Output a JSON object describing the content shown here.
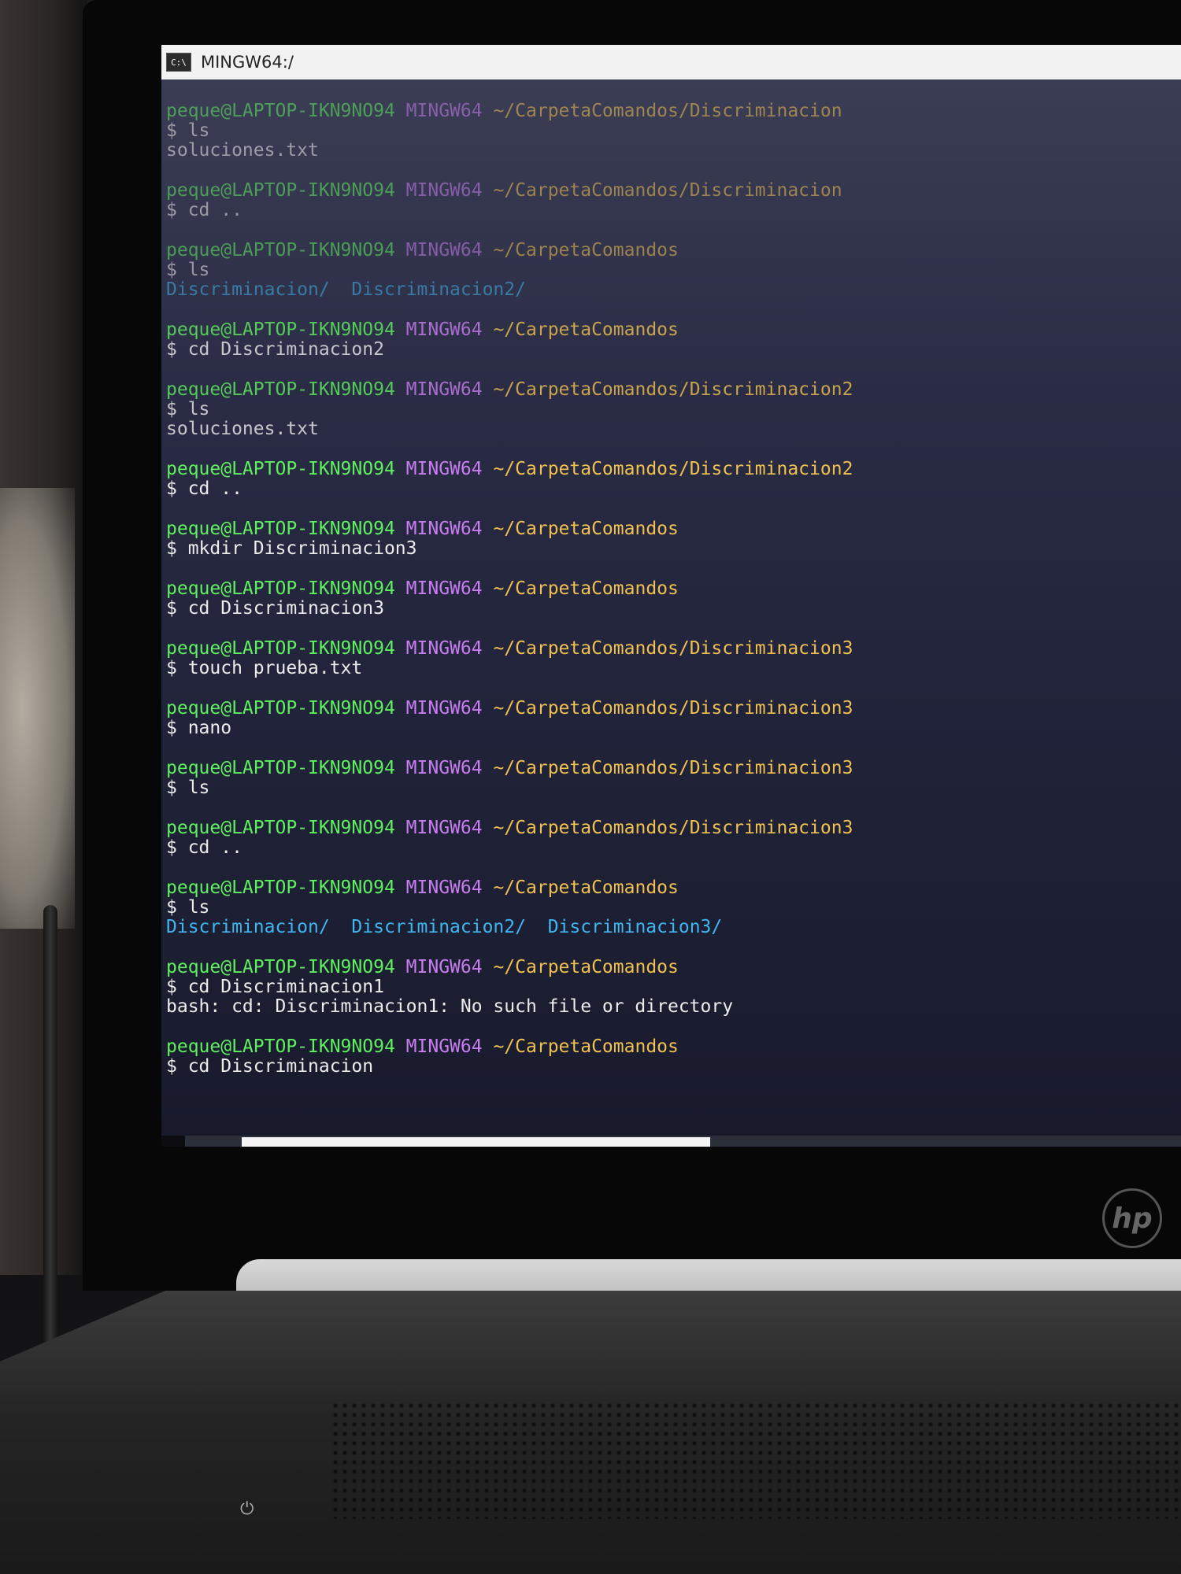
{
  "window": {
    "icon_text": "C:\\",
    "title": "MINGW64:/"
  },
  "terminal": {
    "blocks": [
      {
        "user": "peque@LAPTOP-IKN9NO94",
        "system": "MINGW64",
        "path": "~/CarpetaComandos/Discriminacion",
        "command": "$ ls",
        "output": "soluciones.txt"
      },
      {
        "user": "peque@LAPTOP-IKN9NO94",
        "system": "MINGW64",
        "path": "~/CarpetaComandos/Discriminacion",
        "command": "$ cd .."
      },
      {
        "user": "peque@LAPTOP-IKN9NO94",
        "system": "MINGW64",
        "path": "~/CarpetaComandos",
        "command": "$ ls",
        "dirs": [
          "Discriminacion/",
          "Discriminacion2/"
        ]
      },
      {
        "user": "peque@LAPTOP-IKN9NO94",
        "system": "MINGW64",
        "path": "~/CarpetaComandos",
        "command": "$ cd Discriminacion2"
      },
      {
        "user": "peque@LAPTOP-IKN9NO94",
        "system": "MINGW64",
        "path": "~/CarpetaComandos/Discriminacion2",
        "command": "$ ls",
        "output": "soluciones.txt"
      },
      {
        "user": "peque@LAPTOP-IKN9NO94",
        "system": "MINGW64",
        "path": "~/CarpetaComandos/Discriminacion2",
        "command": "$ cd .."
      },
      {
        "user": "peque@LAPTOP-IKN9NO94",
        "system": "MINGW64",
        "path": "~/CarpetaComandos",
        "command": "$ mkdir Discriminacion3"
      },
      {
        "user": "peque@LAPTOP-IKN9NO94",
        "system": "MINGW64",
        "path": "~/CarpetaComandos",
        "command": "$ cd Discriminacion3"
      },
      {
        "user": "peque@LAPTOP-IKN9NO94",
        "system": "MINGW64",
        "path": "~/CarpetaComandos/Discriminacion3",
        "command": "$ touch prueba.txt"
      },
      {
        "user": "peque@LAPTOP-IKN9NO94",
        "system": "MINGW64",
        "path": "~/CarpetaComandos/Discriminacion3",
        "command": "$ nano"
      },
      {
        "user": "peque@LAPTOP-IKN9NO94",
        "system": "MINGW64",
        "path": "~/CarpetaComandos/Discriminacion3",
        "command": "$ ls"
      },
      {
        "user": "peque@LAPTOP-IKN9NO94",
        "system": "MINGW64",
        "path": "~/CarpetaComandos/Discriminacion3",
        "command": "$ cd .."
      },
      {
        "user": "peque@LAPTOP-IKN9NO94",
        "system": "MINGW64",
        "path": "~/CarpetaComandos",
        "command": "$ ls",
        "dirs": [
          "Discriminacion/",
          "Discriminacion2/",
          "Discriminacion3/"
        ]
      },
      {
        "user": "peque@LAPTOP-IKN9NO94",
        "system": "MINGW64",
        "path": "~/CarpetaComandos",
        "command": "$ cd Discriminacion1",
        "output": "bash: cd: Discriminacion1: No such file or directory"
      },
      {
        "user": "peque@LAPTOP-IKN9NO94",
        "system": "MINGW64",
        "path": "~/CarpetaComandos",
        "command": "$ cd Discriminacion"
      }
    ]
  },
  "taskbar": {
    "icons": [
      "windows-start-icon",
      "cortana-icon",
      "task-view-icon",
      "store-icon",
      "mail-icon",
      "file-explorer-icon",
      "visual-studio-icon",
      "opera-icon"
    ]
  },
  "laptop": {
    "brand": "hp"
  },
  "colors": {
    "user": "#5ff05f",
    "system": "#c87df0",
    "path": "#f0c050",
    "directory": "#3fb6f0",
    "terminal_bg": "#2a2c45"
  }
}
